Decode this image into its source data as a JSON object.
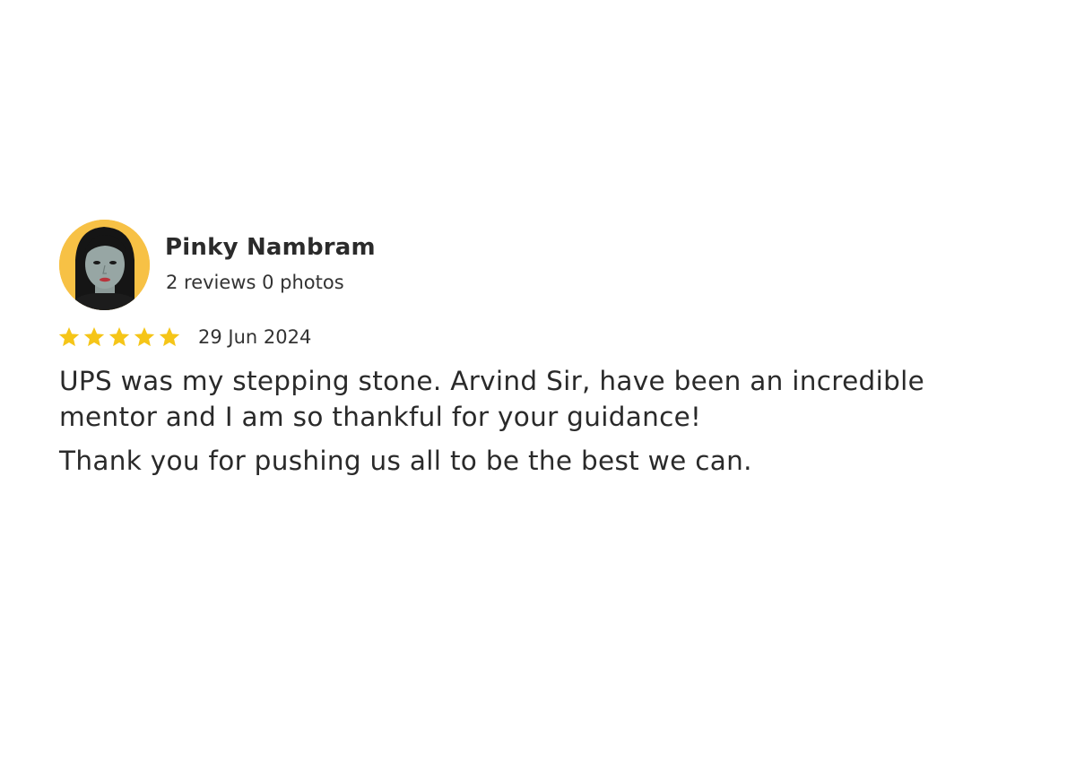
{
  "reviewer": {
    "name": "Pinky Nambram",
    "stats": "2 reviews 0 photos",
    "avatar_bg": "#f7c145"
  },
  "review": {
    "rating": 5,
    "rating_max": 5,
    "star_color": "#f5c518",
    "date": "29 Jun 2024",
    "paragraph_1": "UPS was my stepping stone. Arvind Sir, have been an incredible mentor and I am so thankful for your guidance!",
    "paragraph_2": "Thank you for pushing us all to be the best we can."
  },
  "icons": {
    "star": "star-icon",
    "avatar": "profile-photo"
  }
}
